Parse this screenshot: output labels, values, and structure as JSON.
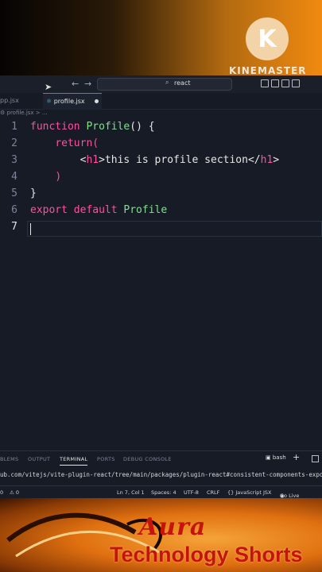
{
  "watermark": {
    "brand": "KINEMASTER",
    "logo_letter": "K"
  },
  "titlebar": {
    "search_text": "react",
    "back_arrow": "←",
    "forward_arrow": "→"
  },
  "tabs": [
    {
      "label": "pp.jsx",
      "active": false
    },
    {
      "label": "profile.jsx",
      "active": true,
      "modified": true
    }
  ],
  "breadcrumb": "⚙ profile.jsx > ...",
  "editor": {
    "lines": [
      {
        "n": "1"
      },
      {
        "n": "2"
      },
      {
        "n": "3"
      },
      {
        "n": "4"
      },
      {
        "n": "5"
      },
      {
        "n": "6"
      },
      {
        "n": "7"
      }
    ],
    "tokens": {
      "l1_kw": "function",
      "l1_fn": "Profile",
      "l1_rest": "() {",
      "l2_kw": "return",
      "l2_rest": "(",
      "l3_open_lt": "<",
      "l3_open_tag": "h1",
      "l3_open_gt": ">",
      "l3_text": "this is profile section",
      "l3_close_lt": "</",
      "l3_close_tag": "h1",
      "l3_close_gt": ">",
      "l4": ")",
      "l5": "}",
      "l6_kw": "export default",
      "l6_fn": "Profile"
    }
  },
  "panel": {
    "tabs": [
      "BLEMS",
      "OUTPUT",
      "TERMINAL",
      "PORTS",
      "DEBUG CONSOLE"
    ],
    "active_tab": "TERMINAL",
    "shell": "bash",
    "terminal_line": "ub.com/vitejs/vite-plugin-react/tree/main/packages/plugin-react#consistent-components-exports"
  },
  "statusbar": {
    "errors": "0",
    "warnings": "⚠ 0",
    "position": "Ln 7, Col 1",
    "spaces": "Spaces: 4",
    "encoding": "UTF-8",
    "eol": "CRLF",
    "language": "{} JavaScript JSX",
    "golive": "Go Live"
  },
  "bottom_brand": {
    "aura": "Aura",
    "tagline": "Technology Shorts"
  },
  "colors": {
    "keyword": "#ff4fa0",
    "function": "#7fe08e",
    "editor_bg": "#171b26",
    "brand_red": "#c4140c"
  }
}
